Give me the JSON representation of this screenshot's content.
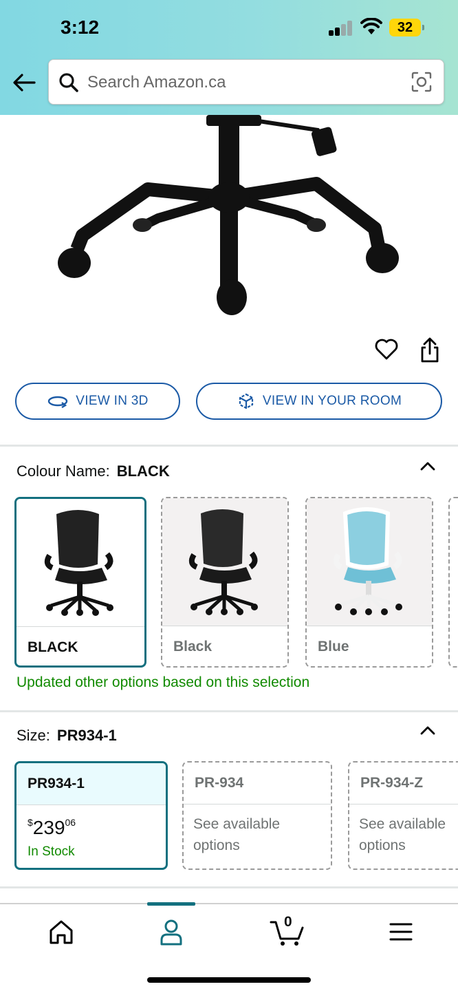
{
  "status_bar": {
    "time": "3:12",
    "battery": "32"
  },
  "search": {
    "placeholder": "Search Amazon.ca"
  },
  "view_3d_label": "VIEW IN 3D",
  "view_room_label": "VIEW IN YOUR ROOM",
  "colour": {
    "label": "Colour Name:",
    "selected_value": "BLACK",
    "options": [
      {
        "name": "BLACK",
        "selected": true
      },
      {
        "name": "Black",
        "selected": false
      },
      {
        "name": "Blue",
        "selected": false
      }
    ],
    "note": "Updated other options based on this selection"
  },
  "size": {
    "label": "Size:",
    "selected_value": "PR934-1",
    "options": [
      {
        "name": "PR934-1",
        "price_whole": "239",
        "price_fraction": "06",
        "currency": "$",
        "stock": "In Stock",
        "selected": true
      },
      {
        "name": "PR-934",
        "see_options": "See available options",
        "selected": false
      },
      {
        "name": "PR-934-Z",
        "see_options": "See available options",
        "selected": false
      }
    ]
  },
  "bottom_nav": {
    "cart_count": "0",
    "items": [
      "home",
      "account",
      "cart",
      "menu"
    ]
  },
  "colors": {
    "accent": "#13707f",
    "link": "#1b5aa6",
    "in_stock": "#118a00"
  }
}
